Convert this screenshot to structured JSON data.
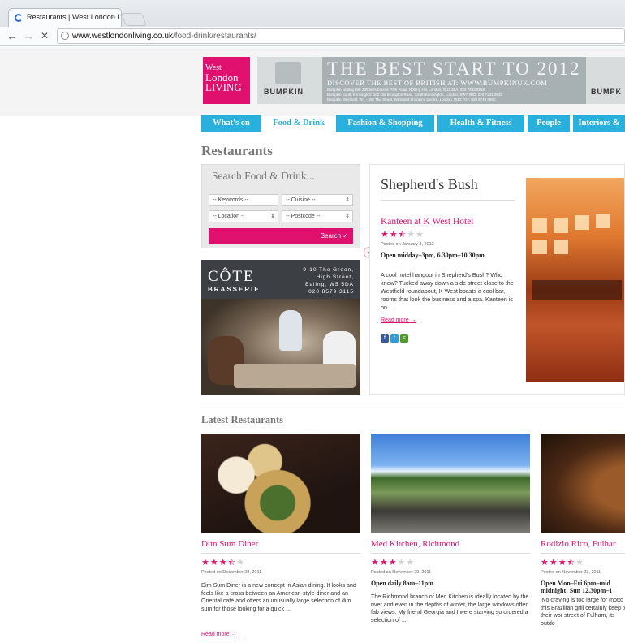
{
  "browser": {
    "tab_title": "Restaurants | West London L",
    "tab_close": "×",
    "url_host": "www.westlondonliving.co.uk",
    "url_path": "/food-drink/restaurants/",
    "back": "←",
    "forward": "→",
    "stop": "✕"
  },
  "site": {
    "logo": {
      "line1": "West",
      "line2": "London",
      "line3": "LIVING"
    },
    "banner": {
      "brand": "BUMPKIN",
      "title": "THE BEST START TO 2012",
      "subtitle": "DISCOVER THE BEST OF BRITISH AT: WWW.BUMPKINUK.COM",
      "line1": "Bumpkin Notting Hill: 209 Westbourne Park Road, Notting Hill, London, W11 1EA, 020 7243 9818",
      "line2": "Bumpkin South Kensington: 102 Old Brompton Road, South Kensington, London, SW7 3RD, 020 7341 0802",
      "line3": "Bumpkin Westfield: W1 - 406 The Street, Westfield Shopping Centre, London, W12 7GF, 020 8749 6980",
      "brand_right": "BUMPK"
    },
    "nav": [
      {
        "label": "What's on",
        "active": false
      },
      {
        "label": "Food & Drink",
        "active": true
      },
      {
        "label": "Fashion & Shopping",
        "active": false
      },
      {
        "label": "Health & Fitness",
        "active": false
      },
      {
        "label": "People",
        "active": false
      },
      {
        "label": "Interiors &",
        "active": false
      }
    ]
  },
  "page_title": "Restaurants",
  "search": {
    "title": "Search Food & Drink...",
    "keywords": "-- Keywords --",
    "cuisine": "-- Cuisine --",
    "location": "-- Location --",
    "postcode": "-- Postcode --",
    "button": "Search ✓"
  },
  "ad": {
    "brand": "CÔTE",
    "sub": "BRASSERIE",
    "addr1": "9-10 The Green,",
    "addr2": "High Street,",
    "addr3": "Ealing, W5 5DA",
    "phone": "020 8579 3115"
  },
  "featured": {
    "area": "Shepherd's Bush",
    "name": "Kanteen at K West Hotel",
    "rating": 2.5,
    "posted": "Posted on January 3, 2012",
    "hours": "Open midday–3pm, 6.30pm–10.30pm",
    "text": "A cool hotel hangout in Shepherd's Bush? Who knew? Tucked away down a side street close to the Westfield roundabout, K West boasts a cool bar, rooms that look the business and a spa. Kanteen is on ...",
    "read_more": "Read more →"
  },
  "latest_title": "Latest Restaurants",
  "latest": [
    {
      "name": "Dim Sum Diner",
      "rating": 3.5,
      "posted": "Posted on December 28, 2011",
      "hours": "",
      "text": "Dim Sum Diner is a new concept in Asian dining. It looks and feels like a cross between an American-style diner and an Oriental café and offers an unusually large selection of dim sum for those looking for a quick ...",
      "read_more": "Read more →"
    },
    {
      "name": "Med Kitchen, Richmond",
      "rating": 3,
      "posted": "Posted on November 29, 2011",
      "hours": "Open daily 8am–11pm",
      "text": "The Richmond branch of Med Kitchen is ideally located by the river and even in the depths of winter, the large windows offer fab views. My friend Georgia and I were starving so ordered a selection of ...",
      "read_more": ""
    },
    {
      "name": "Rodizio Rico, Fulhar",
      "rating": 3.5,
      "posted": "Posted on November 23, 2011",
      "hours": "Open Mon–Fri 6pm–mid midnight; Sun 12.30pm–1",
      "text": "'No craving is too large for motto of this Brazilian grill certainly keep to their wor street of Fulham, its outdo",
      "read_more": ""
    }
  ],
  "colors": {
    "pink": "#e0106f",
    "nav_blue": "#2ab0dc"
  }
}
